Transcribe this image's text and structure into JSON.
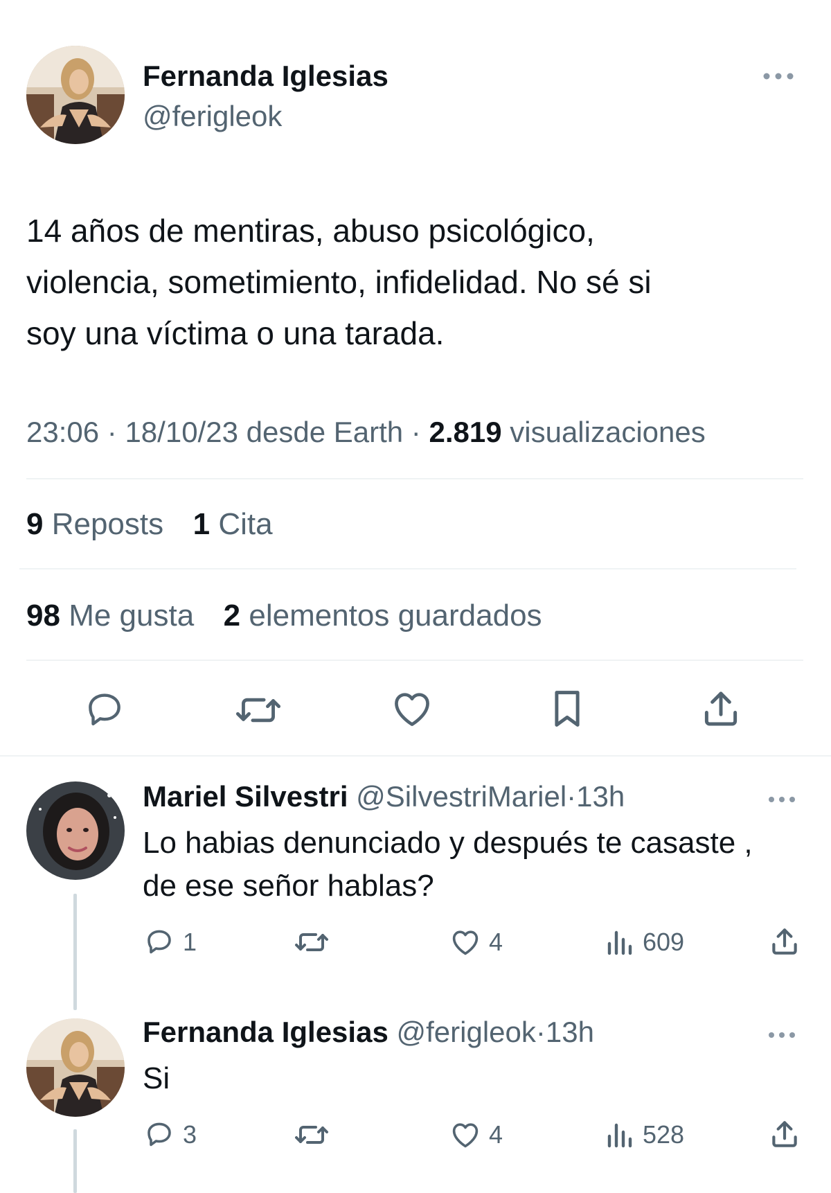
{
  "tweet": {
    "author_name": "Fernanda Iglesias",
    "author_handle": "@ferigleok",
    "more_icon": "more-horizontal-icon",
    "text_lines": [
      "14 años de mentiras, abuso psicológico,",
      "violencia, sometimiento, infidelidad. No sé si",
      "soy una víctima o una tarada."
    ],
    "meta": {
      "time": "23:06",
      "date": "18/10/23",
      "source": "desde Earth",
      "views_count": "2.819",
      "views_label": "visualizaciones",
      "sep": "·"
    },
    "stats": {
      "reposts_count": "9",
      "reposts_label": "Reposts",
      "quotes_count": "1",
      "quotes_label": "Cita",
      "likes_count": "98",
      "likes_label": "Me gusta",
      "bookmarks_count": "2",
      "bookmarks_label": "elementos guardados"
    },
    "actions": [
      "reply-icon",
      "repost-icon",
      "like-icon",
      "bookmark-icon",
      "share-icon"
    ]
  },
  "replies": [
    {
      "author_name": "Mariel Silvestri",
      "author_handle": "@SilvestriMariel",
      "sep": "·",
      "time": "13h",
      "text_lines": [
        "Lo habias denunciado y después te casaste ,",
        "de ese señor hablas?"
      ],
      "reply_count": "1",
      "repost_count": "",
      "like_count": "4",
      "views_count": "609"
    },
    {
      "author_name": "Fernanda Iglesias",
      "author_handle": "@ferigleok",
      "sep": "·",
      "time": "13h",
      "text_lines": [
        "Si"
      ],
      "reply_count": "3",
      "repost_count": "",
      "like_count": "4",
      "views_count": "528"
    }
  ],
  "colors": {
    "text": "#0f1419",
    "muted": "#536471",
    "divider": "#eff3f4",
    "thread_line": "#cfd9de"
  }
}
